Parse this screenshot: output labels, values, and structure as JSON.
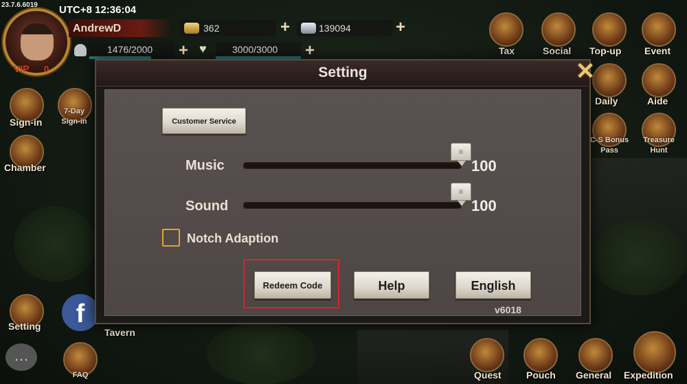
{
  "hud": {
    "client_version": "23.7.6.6019",
    "clock": "UTC+8 12:36:04",
    "player_name": "AndrewD",
    "vip_label": "VIP",
    "vip_level": "0",
    "gold": "362",
    "silver": "139094",
    "troops": "1476/2000",
    "stamina": "3000/3000"
  },
  "right_menu": {
    "tax": "Tax",
    "social": "Social",
    "topup": "Top-up",
    "event": "Event",
    "daily": "Daily",
    "aide": "Aide",
    "cs_bonus": "C-S Bonus",
    "cs_bonus_2": "Pass",
    "treasure": "Treasure",
    "treasure_2": "Hunt"
  },
  "left_menu": {
    "signin": "Sign-in",
    "seven_day": "7-Day",
    "seven_day_2": "Sign-in",
    "chamber": "Chamber",
    "setting": "Setting",
    "tavern": "Tavern",
    "faq": "FAQ"
  },
  "bottom_menu": {
    "quest": "Quest",
    "pouch": "Pouch",
    "general": "General",
    "expedition": "Expedition"
  },
  "dialog": {
    "title": "Setting",
    "customer_service": "Customer Service",
    "music_label": "Music",
    "music_value": "100",
    "sound_label": "Sound",
    "sound_value": "100",
    "notch_label": "Notch Adaption",
    "notch_checked": false,
    "redeem_code": "Redeem Code",
    "help": "Help",
    "language": "English",
    "app_version": "v6018"
  },
  "levels": {
    "music": 1.0,
    "sound": 1.0
  },
  "colors": {
    "highlight": "#e0202a",
    "checkbox": "#e4a52a",
    "vip": "#d63a1e"
  },
  "icons": {
    "close": "close-icon",
    "facebook": "facebook-icon",
    "chat": "chat-icon"
  }
}
